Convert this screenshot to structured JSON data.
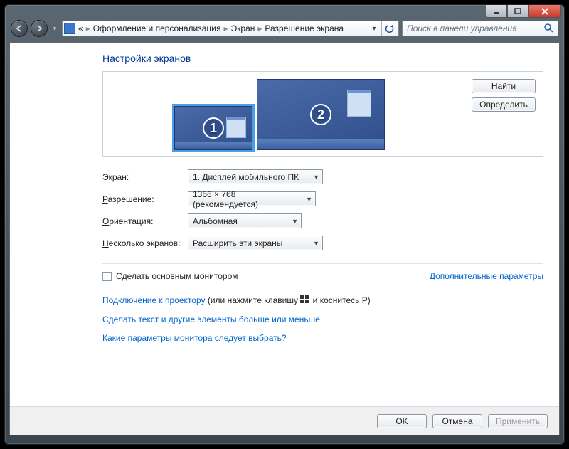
{
  "breadcrumb": {
    "root_marker": "«",
    "seg1": "Оформление и персонализация",
    "seg2": "Экран",
    "seg3": "Разрешение экрана"
  },
  "search": {
    "placeholder": "Поиск в панели управления"
  },
  "page": {
    "title": "Настройки экранов"
  },
  "monitors": {
    "one": "1",
    "two": "2"
  },
  "panel": {
    "find": "Найти",
    "detect": "Определить"
  },
  "form": {
    "display_label_pre": "Э",
    "display_label_rest": "кран:",
    "display_value": "1. Дисплей мобильного ПК",
    "res_label_pre": "Р",
    "res_label_rest": "азрешение:",
    "res_value": "1366 × 768 (рекомендуется)",
    "orient_label_pre": "О",
    "orient_label_rest": "риентация:",
    "orient_value": "Альбомная",
    "multi_label_pre": "Н",
    "multi_label_rest": "есколько экранов:",
    "multi_value": "Расширить эти экраны"
  },
  "primary": {
    "label": "Сделать основным монитором"
  },
  "links": {
    "advanced": "Дополнительные параметры",
    "projector_link": "Подключение к проектору",
    "projector_plain": " (или нажмите клавишу ",
    "projector_tail": " и коснитесь P)",
    "textsize": "Сделать текст и другие элементы больше или меньше",
    "which": "Какие параметры монитора следует выбрать?"
  },
  "buttons": {
    "ok": "OK",
    "cancel": "Отмена",
    "apply": "Применить"
  }
}
